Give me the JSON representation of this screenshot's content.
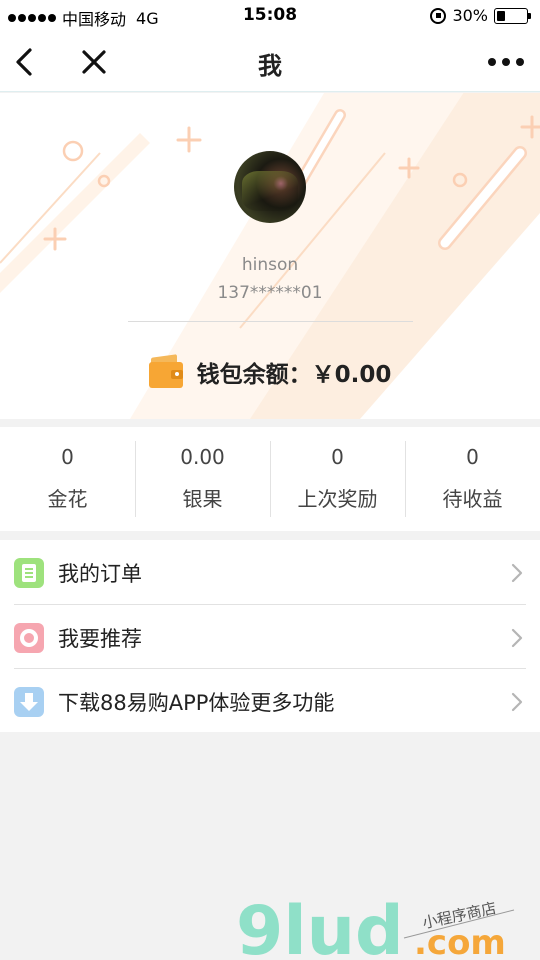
{
  "status_bar": {
    "carrier": "中国移动",
    "network": "4G",
    "time": "15:08",
    "battery": "30%",
    "battery_level": 0.3
  },
  "nav": {
    "title": "我"
  },
  "profile": {
    "username": "hinson",
    "phone": "137******01",
    "wallet_label": "钱包余额：￥0.00"
  },
  "stats": [
    {
      "value": "0",
      "label": "金花"
    },
    {
      "value": "0.00",
      "label": "银果"
    },
    {
      "value": "0",
      "label": "上次奖励"
    },
    {
      "value": "0",
      "label": "待收益"
    }
  ],
  "menu": [
    {
      "label": "我的订单",
      "icon": "orders-icon"
    },
    {
      "label": "我要推荐",
      "icon": "recommend-icon"
    },
    {
      "label": "下载88易购APP体验更多功能",
      "icon": "download-icon"
    }
  ],
  "watermark": {
    "logo": "9lud",
    "domain": ".com",
    "tagline": "小程序商店"
  }
}
